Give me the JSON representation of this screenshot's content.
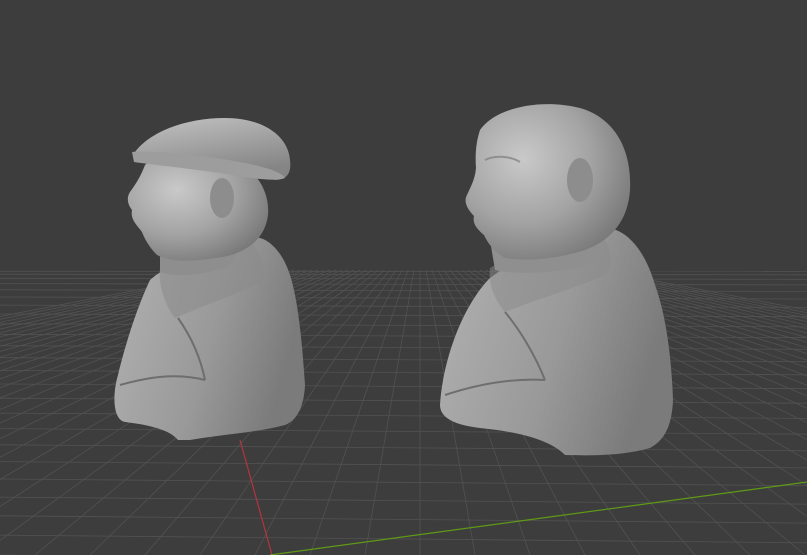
{
  "viewport": {
    "background_color": "#3d3d3d",
    "grid_color": "#525252",
    "x_axis_color": "#b5343f",
    "y_axis_color": "#5f9a16",
    "mesh_color": "#9c9c9c",
    "mesh_shadow_color": "#6f6f6f",
    "mesh_highlight_color": "#c4c4c4"
  },
  "objects": [
    {
      "id": "bust-with-cap",
      "icon": "sculpture-bust-with-flat-cap"
    },
    {
      "id": "bust-bareheaded",
      "icon": "sculpture-bust-bareheaded"
    }
  ]
}
